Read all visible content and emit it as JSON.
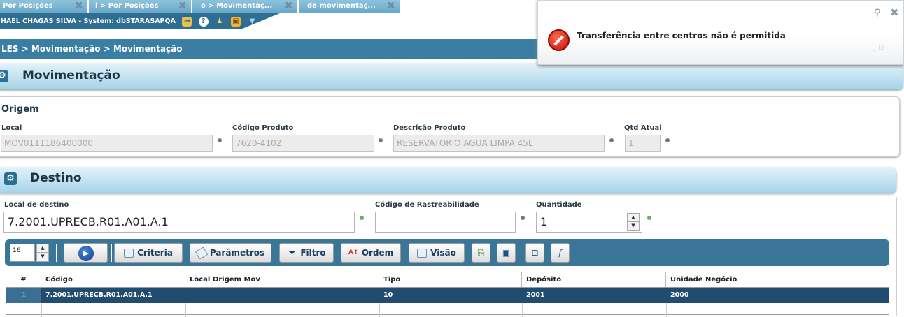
{
  "tabs": [
    {
      "label": "Por Posições"
    },
    {
      "label": "l > Por Posições"
    },
    {
      "label": "o > Movimentaç..."
    },
    {
      "label": "de movimentaç..."
    }
  ],
  "user_bar": {
    "text": "HAEL CHAGAS SILVA - System: dbSTARASAPQA"
  },
  "breadcrumb": "LES > Movimentação > Movimentação",
  "page_title": "Movimentação",
  "origem": {
    "title": "Origem",
    "local_label": "Local",
    "local_value": "MOV0111186400000",
    "codigo_label": "Código Produto",
    "codigo_value": "7620-4102",
    "descricao_label": "Descrição Produto",
    "descricao_value": "RESERVATORIO AGUA LIMPA 45L",
    "qtd_label": "Qtd Atual",
    "qtd_value": "1"
  },
  "destino": {
    "title": "Destino",
    "local_label": "Local de destino",
    "local_value": "7.2001.UPRECB.R01.A01.A.1",
    "rastreabilidade_label": "Código de Rastreabilidade",
    "rastreabilidade_value": "",
    "quantidade_label": "Quantidade",
    "quantidade_value": "1"
  },
  "toolbar": {
    "page_size": "16",
    "criteria": "Criteria",
    "parametros": "Parâmetros",
    "filtro": "Filtro",
    "ordem": "Ordem",
    "visao": "Visão"
  },
  "grid": {
    "headers": [
      "#",
      "Código",
      "Local Origem Mov",
      "Tipo",
      "Depósito",
      "Unidade Negócio"
    ],
    "rows": [
      [
        "1",
        "7.2001.UPRECB.R01.A01.A.1",
        "",
        "10",
        "2001",
        "2000"
      ]
    ]
  },
  "toast": {
    "message": "Transferência entre centros não é permitida"
  },
  "colors": {
    "accent": "#3a7fa3",
    "header": "#2e6e93",
    "selected_row": "#214c6f",
    "error": "#c31010"
  }
}
